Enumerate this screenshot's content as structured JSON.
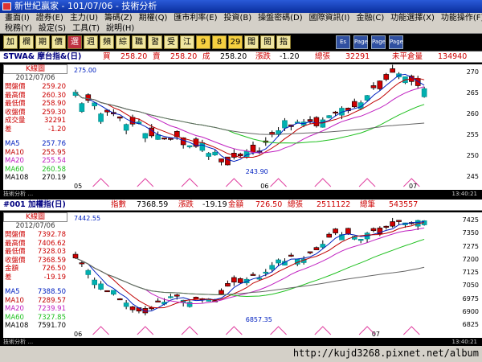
{
  "window": {
    "title": "新世紀贏家 - 101/07/06 - 技術分析"
  },
  "menu": {
    "row1": [
      "畫面(I)",
      "證券(E)",
      "主力(U)",
      "籌碼(Z)",
      "期權(Q)",
      "匯市利率(E)",
      "投資(B)",
      "操盤密碼(D)",
      "國際資訊(I)",
      "金融(C)",
      "功能選擇(X)",
      "功能操作(F)"
    ],
    "row2": [
      "稅務(Y)",
      "設定(S)",
      "工具(T)",
      "說明(H)"
    ]
  },
  "toolbar": {
    "buttons": [
      "加",
      "欄",
      "期",
      "價",
      "選",
      "週",
      "頻",
      "綜",
      "職",
      "習",
      "受",
      "江"
    ],
    "numbers": [
      "9",
      "8",
      "29"
    ],
    "extra": [
      "闊",
      "閱",
      "指"
    ],
    "icons": [
      "Es",
      "Page",
      "Page",
      "Page"
    ]
  },
  "panel1": {
    "code": "STWA& 摩台指&(日)",
    "buy_label": "買",
    "buy": "258.20",
    "sell_label": "賣",
    "sell": "258.20",
    "deal_label": "成",
    "deal": "258.20",
    "change_label": "漲跌",
    "change": "-1.20",
    "volume_label": "總張",
    "volume": "32291",
    "oi_label": "未平倉量",
    "oi": "134940",
    "info_title": "K線圖",
    "date": "2012/07/06",
    "rows": [
      {
        "label": "開盤價",
        "value": "259.20"
      },
      {
        "label": "最高價",
        "value": "260.30"
      },
      {
        "label": "最低價",
        "value": "258.90"
      },
      {
        "label": "收盤價",
        "value": "259.30"
      },
      {
        "label": "成交量",
        "value": "32291"
      },
      {
        "label": "差",
        "value": "-1.20"
      }
    ],
    "ma": [
      {
        "label": "MA5",
        "value": "257.76"
      },
      {
        "label": "MA10",
        "value": "255.95"
      },
      {
        "label": "MA20",
        "value": "255.54"
      },
      {
        "label": "MA60",
        "value": "260.58"
      },
      {
        "label": "MA108",
        "value": "270.19"
      }
    ],
    "high_label": "275.00",
    "low_label": "243.90",
    "ticks": [
      "270",
      "265",
      "260",
      "255",
      "250",
      "245"
    ],
    "months": [
      "05",
      "06",
      "07"
    ],
    "status": "技術分析 …",
    "time": "13:40:21"
  },
  "panel2": {
    "code": "#001 加權指(日)",
    "idx_label": "指數",
    "idx": "7368.59",
    "change_label": "漲跌",
    "change": "-19.19",
    "amount_label": "金額",
    "amount": "726.50",
    "vol_label": "總張",
    "vol": "2511122",
    "count_label": "總筆",
    "count": "543557",
    "info_title": "K線圖",
    "date": "2012/07/06",
    "rows": [
      {
        "label": "開盤價",
        "value": "7392.78"
      },
      {
        "label": "最高價",
        "value": "7406.62"
      },
      {
        "label": "最低價",
        "value": "7328.03"
      },
      {
        "label": "收盤價",
        "value": "7368.59"
      },
      {
        "label": "金額",
        "value": "726.50"
      },
      {
        "label": "差",
        "value": "-19.19"
      }
    ],
    "ma": [
      {
        "label": "MA5",
        "value": "7388.50"
      },
      {
        "label": "MA10",
        "value": "7289.57"
      },
      {
        "label": "MA20",
        "value": "7239.91"
      },
      {
        "label": "MA60",
        "value": "7327.85"
      },
      {
        "label": "MA108",
        "value": "7591.70"
      }
    ],
    "high_label": "7442.55",
    "low_label": "6857.35",
    "ticks": [
      "7425",
      "7350",
      "7275",
      "7200",
      "7125",
      "7050",
      "6975",
      "6900",
      "6825"
    ],
    "months": [
      "06",
      "07"
    ],
    "status": "技術分析 …",
    "time": "13:40:21"
  },
  "footer": {
    "url": "http://kujd3268.pixnet.net/album"
  },
  "colors": {
    "up": "#d00000",
    "down": "#00b0b0",
    "ma5": "#0020c0",
    "ma10": "#c00000",
    "ma20": "#c020c0",
    "ma60": "#20c020"
  }
}
